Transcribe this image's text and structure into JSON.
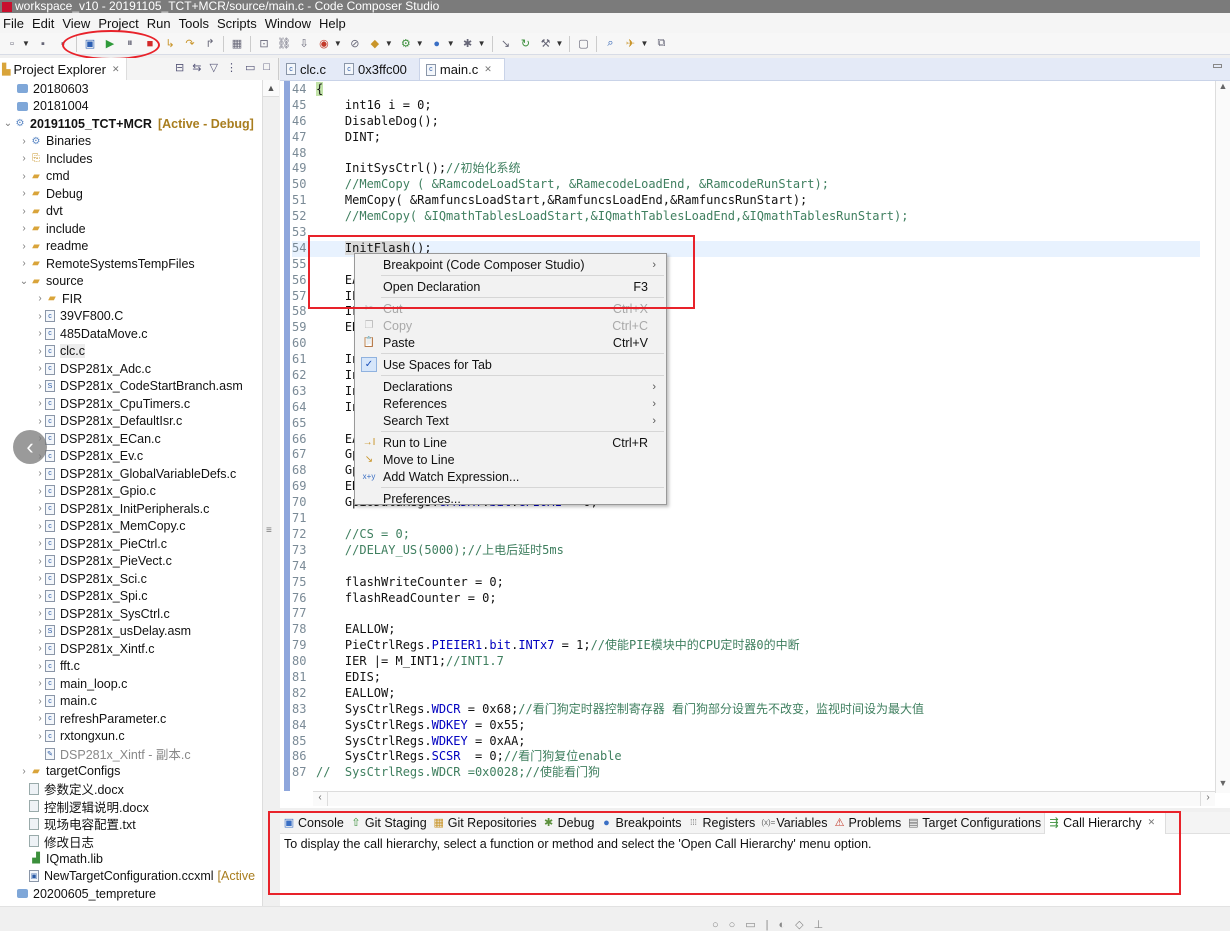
{
  "window": {
    "title": "workspace_v10 - 20191105_TCT+MCR/source/main.c - Code Composer Studio"
  },
  "menubar": [
    "File",
    "Edit",
    "View",
    "Project",
    "Run",
    "Tools",
    "Scripts",
    "Window",
    "Help"
  ],
  "toolbar": {
    "icons": [
      {
        "name": "new-icon",
        "glyph": "▫"
      },
      {
        "name": "save-icon",
        "glyph": "▪"
      },
      {
        "name": "save-all-icon",
        "glyph": "▪"
      },
      {
        "name": "connect-target-icon",
        "glyph": "▣"
      },
      {
        "name": "resume-icon",
        "glyph": "▶"
      },
      {
        "name": "suspend-icon",
        "glyph": "⏸"
      },
      {
        "name": "terminate-icon",
        "glyph": "■"
      },
      {
        "name": "step-into-icon",
        "glyph": "↳"
      },
      {
        "name": "step-over-icon",
        "glyph": "↷"
      },
      {
        "name": "step-return-icon",
        "glyph": "↱"
      },
      {
        "name": "memory-browser-icon",
        "glyph": "▦"
      },
      {
        "name": "debug-view-icon",
        "glyph": "⊡"
      },
      {
        "name": "link-icon",
        "glyph": "⛓"
      },
      {
        "name": "load-program-icon",
        "glyph": "⇩"
      },
      {
        "name": "breakpoint-icon",
        "glyph": "◉"
      },
      {
        "name": "skip-breakpoints-icon",
        "glyph": "⊘"
      },
      {
        "name": "build-icon",
        "glyph": "◆"
      },
      {
        "name": "debug-launch-icon",
        "glyph": "⚙"
      },
      {
        "name": "run-launch-icon",
        "glyph": "●"
      },
      {
        "name": "tools-icon",
        "glyph": "✱"
      },
      {
        "name": "assembly-step-into-icon",
        "glyph": "↘"
      },
      {
        "name": "assembly-step-over-icon",
        "glyph": "↻"
      },
      {
        "name": "hammer-icon",
        "glyph": "⚒"
      },
      {
        "name": "console-view-icon",
        "glyph": "▢"
      },
      {
        "name": "search-icon",
        "glyph": "⌕"
      },
      {
        "name": "launch-icon",
        "glyph": "✈"
      },
      {
        "name": "open-perspective-icon",
        "glyph": "⧉"
      }
    ]
  },
  "explorer": {
    "title": "Project Explorer",
    "tree": [
      {
        "label": "20180603",
        "indent": 0,
        "twisty": "",
        "icon": "project"
      },
      {
        "label": "20181004",
        "indent": 0,
        "twisty": "",
        "icon": "project"
      },
      {
        "label": "20191105_TCT+MCR",
        "indent": 0,
        "twisty": "v",
        "icon": "project-open",
        "bold": true,
        "tag": "[Active - Debug]"
      },
      {
        "label": "Binaries",
        "indent": 1,
        "twisty": ">",
        "icon": "binaries"
      },
      {
        "label": "Includes",
        "indent": 1,
        "twisty": ">",
        "icon": "includes"
      },
      {
        "label": "cmd",
        "indent": 1,
        "twisty": ">",
        "icon": "folder"
      },
      {
        "label": "Debug",
        "indent": 1,
        "twisty": ">",
        "icon": "folder"
      },
      {
        "label": "dvt",
        "indent": 1,
        "twisty": ">",
        "icon": "folder"
      },
      {
        "label": "include",
        "indent": 1,
        "twisty": ">",
        "icon": "folder"
      },
      {
        "label": "readme",
        "indent": 1,
        "twisty": ">",
        "icon": "folder"
      },
      {
        "label": "RemoteSystemsTempFiles",
        "indent": 1,
        "twisty": ">",
        "icon": "folder"
      },
      {
        "label": "source",
        "indent": 1,
        "twisty": "v",
        "icon": "folder"
      },
      {
        "label": "FIR",
        "indent": 2,
        "twisty": ">",
        "icon": "folder"
      },
      {
        "label": "39VF800.C",
        "indent": 2,
        "twisty": ">",
        "icon": "c"
      },
      {
        "label": "485DataMove.c",
        "indent": 2,
        "twisty": ">",
        "icon": "c"
      },
      {
        "label": "clc.c",
        "indent": 2,
        "twisty": ">",
        "icon": "c",
        "selected": true
      },
      {
        "label": "DSP281x_Adc.c",
        "indent": 2,
        "twisty": ">",
        "icon": "c"
      },
      {
        "label": "DSP281x_CodeStartBranch.asm",
        "indent": 2,
        "twisty": ">",
        "icon": "s"
      },
      {
        "label": "DSP281x_CpuTimers.c",
        "indent": 2,
        "twisty": ">",
        "icon": "c"
      },
      {
        "label": "DSP281x_DefaultIsr.c",
        "indent": 2,
        "twisty": ">",
        "icon": "c"
      },
      {
        "label": "DSP281x_ECan.c",
        "indent": 2,
        "twisty": ">",
        "icon": "c"
      },
      {
        "label": "DSP281x_Ev.c",
        "indent": 2,
        "twisty": ">",
        "icon": "c"
      },
      {
        "label": "DSP281x_GlobalVariableDefs.c",
        "indent": 2,
        "twisty": ">",
        "icon": "c"
      },
      {
        "label": "DSP281x_Gpio.c",
        "indent": 2,
        "twisty": ">",
        "icon": "c"
      },
      {
        "label": "DSP281x_InitPeripherals.c",
        "indent": 2,
        "twisty": ">",
        "icon": "c"
      },
      {
        "label": "DSP281x_MemCopy.c",
        "indent": 2,
        "twisty": ">",
        "icon": "c"
      },
      {
        "label": "DSP281x_PieCtrl.c",
        "indent": 2,
        "twisty": ">",
        "icon": "c"
      },
      {
        "label": "DSP281x_PieVect.c",
        "indent": 2,
        "twisty": ">",
        "icon": "c"
      },
      {
        "label": "DSP281x_Sci.c",
        "indent": 2,
        "twisty": ">",
        "icon": "c"
      },
      {
        "label": "DSP281x_Spi.c",
        "indent": 2,
        "twisty": ">",
        "icon": "c"
      },
      {
        "label": "DSP281x_SysCtrl.c",
        "indent": 2,
        "twisty": ">",
        "icon": "c"
      },
      {
        "label": "DSP281x_usDelay.asm",
        "indent": 2,
        "twisty": ">",
        "icon": "s"
      },
      {
        "label": "DSP281x_Xintf.c",
        "indent": 2,
        "twisty": ">",
        "icon": "c"
      },
      {
        "label": "fft.c",
        "indent": 2,
        "twisty": ">",
        "icon": "c"
      },
      {
        "label": "main_loop.c",
        "indent": 2,
        "twisty": ">",
        "icon": "c"
      },
      {
        "label": "main.c",
        "indent": 2,
        "twisty": ">",
        "icon": "c"
      },
      {
        "label": "refreshParameter.c",
        "indent": 2,
        "twisty": ">",
        "icon": "c"
      },
      {
        "label": "rxtongxun.c",
        "indent": 2,
        "twisty": ">",
        "icon": "c"
      },
      {
        "label": "DSP281x_Xintf - 副本.c",
        "indent": 2,
        "twisty": "",
        "icon": "excluded",
        "dim": true
      },
      {
        "label": "targetConfigs",
        "indent": 1,
        "twisty": ">",
        "icon": "folder"
      },
      {
        "label": "参数定义.docx",
        "indent": 1,
        "twisty": "",
        "icon": "doc"
      },
      {
        "label": "控制逻辑说明.docx",
        "indent": 1,
        "twisty": "",
        "icon": "doc"
      },
      {
        "label": "现场电容配置.txt",
        "indent": 1,
        "twisty": "",
        "icon": "doc"
      },
      {
        "label": "修改日志",
        "indent": 1,
        "twisty": "",
        "icon": "doc"
      },
      {
        "label": "IQmath.lib",
        "indent": 1,
        "twisty": "",
        "icon": "lib"
      },
      {
        "label": "NewTargetConfiguration.ccxml",
        "indent": 1,
        "twisty": "",
        "icon": "ccxml",
        "tag2": "[Active"
      },
      {
        "label": "20200605_tempreture",
        "indent": 0,
        "twisty": "",
        "icon": "project"
      }
    ]
  },
  "editor": {
    "tabs": [
      {
        "label": "clc.c",
        "active": false
      },
      {
        "label": "0x3ffc00",
        "active": false
      },
      {
        "label": "main.c",
        "active": true
      }
    ],
    "lines": [
      {
        "n": "44",
        "segs": [
          [
            "brace",
            "{"
          ]
        ]
      },
      {
        "n": "45",
        "segs": [
          [
            "t",
            "    int16 i = 0;"
          ]
        ]
      },
      {
        "n": "46",
        "segs": [
          [
            "t",
            "    DisableDog();"
          ]
        ]
      },
      {
        "n": "47",
        "segs": [
          [
            "t",
            "    DINT;"
          ]
        ]
      },
      {
        "n": "48",
        "segs": []
      },
      {
        "n": "49",
        "segs": [
          [
            "t",
            "    InitSysCtrl();"
          ],
          [
            "c",
            "//初始化系统"
          ]
        ]
      },
      {
        "n": "50",
        "segs": [
          [
            "c",
            "    //MemCopy ( &RamcodeLoadStart, &RamecodeLoadEnd, &RamcodeRunStart);"
          ]
        ]
      },
      {
        "n": "51",
        "segs": [
          [
            "t",
            "    MemCopy( &RamfuncsLoadStart,&RamfuncsLoadEnd,&RamfuncsRunStart);"
          ]
        ]
      },
      {
        "n": "52",
        "segs": [
          [
            "c",
            "    //MemCopy( &IQmathTablesLoadStart,&IQmathTablesLoadEnd,&IQmathTablesRunStart);"
          ]
        ]
      },
      {
        "n": "53",
        "segs": []
      },
      {
        "n": "54",
        "segs": [
          [
            "t",
            "    "
          ],
          [
            "hl",
            "InitFlash"
          ],
          [
            "t",
            "();"
          ]
        ],
        "current": true
      },
      {
        "n": "55",
        "segs": []
      },
      {
        "n": "56",
        "segs": [
          [
            "t",
            "    EALLOW;"
          ]
        ]
      },
      {
        "n": "57",
        "segs": [
          [
            "t",
            "    IER = 0x0000;"
          ]
        ]
      },
      {
        "n": "58",
        "segs": [
          [
            "t",
            "    IFR = 0x0000;"
          ]
        ]
      },
      {
        "n": "59",
        "segs": [
          [
            "t",
            "    EDIS;"
          ]
        ]
      },
      {
        "n": "60",
        "segs": []
      },
      {
        "n": "61",
        "segs": [
          [
            "t",
            "    InitGpio();"
          ]
        ]
      },
      {
        "n": "62",
        "segs": [
          [
            "t",
            "    InitPieCtrl();"
          ]
        ]
      },
      {
        "n": "63",
        "segs": [
          [
            "t",
            "    InitPieVectTable();"
          ]
        ]
      },
      {
        "n": "64",
        "segs": [
          [
            "t",
            "    InitPeripherals();"
          ]
        ]
      },
      {
        "n": "65",
        "segs": []
      },
      {
        "n": "66",
        "segs": [
          [
            "t",
            "    EALLOW;"
          ]
        ]
      },
      {
        "n": "67",
        "segs": [
          [
            "t",
            "    GpioMuxRegs.GPAMUX.all = 0;"
          ]
        ]
      },
      {
        "n": "68",
        "segs": [
          [
            "t",
            "    GpioMuxRegs.GPADIR.all = 0;"
          ]
        ]
      },
      {
        "n": "69",
        "segs": [
          [
            "t",
            "    EDIS;"
          ]
        ]
      },
      {
        "n": "70",
        "segs": [
          [
            "t",
            "    GpioDataRegs."
          ],
          [
            "f",
            "GPADAT"
          ],
          [
            "t",
            "."
          ],
          [
            "f",
            "bit"
          ],
          [
            "t",
            "."
          ],
          [
            "f",
            "GPIOA1"
          ],
          [
            "t",
            " = 0;"
          ]
        ]
      },
      {
        "n": "71",
        "segs": []
      },
      {
        "n": "72",
        "segs": [
          [
            "c",
            "    //CS = 0;"
          ]
        ]
      },
      {
        "n": "73",
        "segs": [
          [
            "c",
            "    //DELAY_US(5000);//上电后延时5ms"
          ]
        ]
      },
      {
        "n": "74",
        "segs": []
      },
      {
        "n": "75",
        "segs": [
          [
            "t",
            "    flashWriteCounter = 0;"
          ]
        ]
      },
      {
        "n": "76",
        "segs": [
          [
            "t",
            "    flashReadCounter = 0;"
          ]
        ]
      },
      {
        "n": "77",
        "segs": []
      },
      {
        "n": "78",
        "segs": [
          [
            "t",
            "    EALLOW;"
          ]
        ]
      },
      {
        "n": "79",
        "segs": [
          [
            "t",
            "    PieCtrlRegs."
          ],
          [
            "f",
            "PIEIER1"
          ],
          [
            "t",
            "."
          ],
          [
            "f",
            "bit"
          ],
          [
            "t",
            "."
          ],
          [
            "f",
            "INTx7"
          ],
          [
            "t",
            " = 1;"
          ],
          [
            "c",
            "//使能PIE模块中的CPU定时器0的中断"
          ]
        ]
      },
      {
        "n": "80",
        "segs": [
          [
            "t",
            "    IER |= M_INT1;"
          ],
          [
            "c",
            "//INT1.7"
          ]
        ]
      },
      {
        "n": "81",
        "segs": [
          [
            "t",
            "    EDIS;"
          ]
        ]
      },
      {
        "n": "82",
        "segs": [
          [
            "t",
            "    EALLOW;"
          ]
        ]
      },
      {
        "n": "83",
        "segs": [
          [
            "t",
            "    SysCtrlRegs."
          ],
          [
            "f",
            "WDCR"
          ],
          [
            "t",
            " = 0x68;"
          ],
          [
            "c",
            "//看门狗定时器控制寄存器 看门狗部分设置先不改变，监视时间设为最大值"
          ]
        ]
      },
      {
        "n": "84",
        "segs": [
          [
            "t",
            "    SysCtrlRegs."
          ],
          [
            "f",
            "WDKEY"
          ],
          [
            "t",
            " = 0x55;"
          ]
        ]
      },
      {
        "n": "85",
        "segs": [
          [
            "t",
            "    SysCtrlRegs."
          ],
          [
            "f",
            "WDKEY"
          ],
          [
            "t",
            " = 0xAA;"
          ]
        ]
      },
      {
        "n": "86",
        "segs": [
          [
            "t",
            "    SysCtrlRegs."
          ],
          [
            "f",
            "SCSR"
          ],
          [
            "t",
            "  = 0;"
          ],
          [
            "c",
            "//看门狗复位enable"
          ]
        ]
      },
      {
        "n": "87",
        "segs": [
          [
            "c",
            "//  SysCtrlRegs.WDCR =0x0028;//使能看门狗"
          ]
        ]
      }
    ]
  },
  "context_menu": {
    "items": [
      {
        "type": "item",
        "label": "Breakpoint (Code Composer Studio)",
        "submenu": true
      },
      {
        "type": "sep"
      },
      {
        "type": "item",
        "label": "Open Declaration",
        "shortcut": "F3"
      },
      {
        "type": "sep"
      },
      {
        "type": "item",
        "label": "Cut",
        "shortcut": "Ctrl+X",
        "disabled": true,
        "icon": "cut-icon",
        "glyph": "✂"
      },
      {
        "type": "item",
        "label": "Copy",
        "shortcut": "Ctrl+C",
        "disabled": true,
        "icon": "copy-icon",
        "glyph": "❐"
      },
      {
        "type": "item",
        "label": "Paste",
        "shortcut": "Ctrl+V",
        "icon": "paste-icon",
        "glyph": "📋"
      },
      {
        "type": "sep"
      },
      {
        "type": "item",
        "label": "Use Spaces for Tab",
        "checked": true,
        "icon": "check-icon",
        "glyph": "✓"
      },
      {
        "type": "sep"
      },
      {
        "type": "item",
        "label": "Declarations",
        "submenu": true
      },
      {
        "type": "item",
        "label": "References",
        "submenu": true
      },
      {
        "type": "item",
        "label": "Search Text",
        "submenu": true
      },
      {
        "type": "sep"
      },
      {
        "type": "item",
        "label": "Run to Line",
        "shortcut": "Ctrl+R",
        "icon": "run-to-line-icon",
        "glyph": "→I"
      },
      {
        "type": "item",
        "label": "Move to Line",
        "icon": "move-to-line-icon",
        "glyph": "↘"
      },
      {
        "type": "item",
        "label": "Add Watch Expression...",
        "icon": "watch-expression-icon",
        "glyph": "x+y"
      },
      {
        "type": "sep"
      },
      {
        "type": "item",
        "label": "Preferences..."
      }
    ]
  },
  "bottom_panel": {
    "tabs": [
      {
        "label": "Console",
        "icon": "console-icon",
        "glyph": "▣",
        "color": "#3a6fc4"
      },
      {
        "label": "Git Staging",
        "icon": "git-staging-icon",
        "glyph": "⇧",
        "color": "#3b8f3b"
      },
      {
        "label": "Git Repositories",
        "icon": "git-repositories-icon",
        "glyph": "▦",
        "color": "#c9952a"
      },
      {
        "label": "Debug",
        "icon": "debug-icon",
        "glyph": "✱",
        "color": "#5b8f3b"
      },
      {
        "label": "Breakpoints",
        "icon": "breakpoints-icon",
        "glyph": "●",
        "color": "#3a6fc4"
      },
      {
        "label": "Registers",
        "icon": "registers-icon",
        "glyph": "⁞⁞⁞",
        "color": "#666"
      },
      {
        "label": "Variables",
        "icon": "variables-icon",
        "glyph": "(x)=",
        "color": "#666"
      },
      {
        "label": "Problems",
        "icon": "problems-icon",
        "glyph": "⚠",
        "color": "#c23a2a"
      },
      {
        "label": "Target Configurations",
        "icon": "target-configurations-icon",
        "glyph": "▤",
        "color": "#666"
      },
      {
        "label": "Call Hierarchy",
        "icon": "call-hierarchy-icon",
        "glyph": "⇶",
        "color": "#3b8f3b",
        "active": true
      }
    ],
    "message": "To display the call hierarchy, select a function or method and select the 'Open Call Hierarchy' menu option."
  },
  "colors": {
    "annotation_red": "#e8222a",
    "comment_green": "#3f7f5f",
    "field_blue": "#0000c0",
    "active_tag": "#a87d1e"
  }
}
